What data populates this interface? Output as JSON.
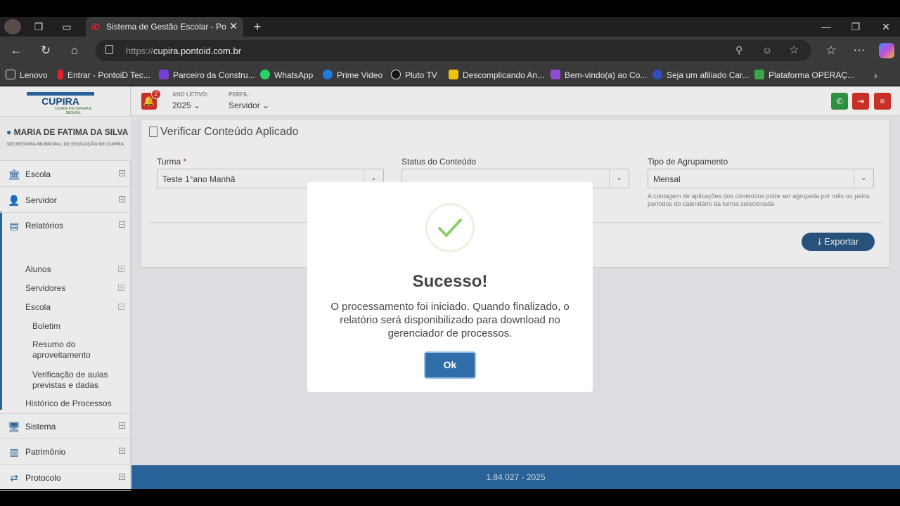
{
  "browser": {
    "tab_title": "Sistema de Gestão Escolar - Ponto",
    "tab_icon": "iD",
    "url_protocol": "https://",
    "url_host": "cupira.pontoid.com.br",
    "bookmarks": [
      {
        "label": "Lenovo",
        "color": "#ffffff"
      },
      {
        "label": "Entrar - PontoiD Tec...",
        "color": "#e0242b"
      },
      {
        "label": "Parceiro da Constru...",
        "color": "#7a3fd6"
      },
      {
        "label": "WhatsApp",
        "color": "#25d366"
      },
      {
        "label": "Prime Video",
        "color": "#1f7ae0"
      },
      {
        "label": "Pluto TV",
        "color": "#111111"
      },
      {
        "label": "Descomplicando An...",
        "color": "#f4c20d"
      },
      {
        "label": "Bem-vindo(a) ao Co...",
        "color": "#8f4ad6"
      },
      {
        "label": "Seja um afiliado Car...",
        "color": "#2d4fbf"
      },
      {
        "label": "Plataforma OPERAÇ...",
        "color": "#3aa84a"
      }
    ]
  },
  "sidebar": {
    "logo_name": "CUPIRA",
    "logo_sub": "CIDADE PROSPERA E SEGURA",
    "user_name": "MARIA DE FATIMA DA SILVA",
    "user_org": "SECRETARIA MUNICIPAL DE EDUCAÇÃO DE CUPIRA",
    "menu": {
      "escola": "Escola",
      "servidor": "Servidor",
      "relatorios": "Relatórios",
      "alunos": "Alunos",
      "servidores": "Servidores",
      "escola_sub": "Escola",
      "boletim": "Boletim",
      "resumo": "Resumo do aproveitamento",
      "verificacao": "Verificação de aulas previstas e dadas",
      "historico": "Histórico de Processos",
      "sistema": "Sistema",
      "patrimonio": "Patrimônio",
      "protocolo": "Protocolo"
    }
  },
  "header": {
    "notif_count": "2",
    "ano_label": "ANO LETIVO:",
    "ano_value": "2025",
    "perfil_label": "PERFIL:",
    "perfil_value": "Servidor"
  },
  "panel": {
    "title": "Verificar Conteúdo Aplicado",
    "turma_label": "Turma",
    "turma_required": "*",
    "turma_value": "Teste 1°ano Manhã",
    "status_label": "Status do Conteúdo",
    "status_value": "",
    "agrup_label": "Tipo de Agrupamento",
    "agrup_value": "Mensal",
    "agrup_hint": "A contagem de aplicações dos conteúdos pode ser agrupada por mês ou pelos períodos do calendário da turma selecionada",
    "export_label": "Exportar"
  },
  "footer": {
    "version": "1.84.027 - 2025"
  },
  "modal": {
    "title": "Sucesso!",
    "message": "O processamento foi iniciado. Quando finalizado, o relatório será disponibilizado para download no gerenciador de processos.",
    "ok_label": "Ok"
  }
}
